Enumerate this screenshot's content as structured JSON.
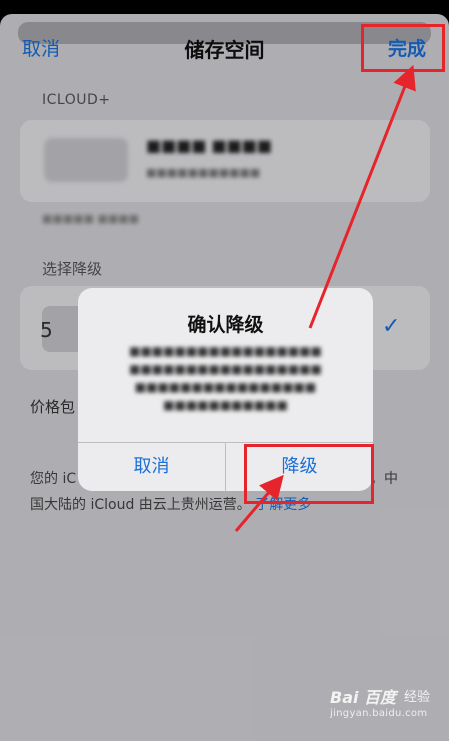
{
  "nav": {
    "cancel_label": "取消",
    "title": "储存空间",
    "done_label": "完成"
  },
  "icloud_section": {
    "header": "ICLOUD+"
  },
  "downgrade_section": {
    "header": "选择降级",
    "option_partial": "5",
    "selected_check": "✓"
  },
  "price_label_partial": "价格包",
  "footer": {
    "line1_left": "您的 iC",
    "line1_right": "销。中",
    "line2_text": "国大陆的 iCloud 由云上贵州运营。",
    "learn_more": "了解更多"
  },
  "alert": {
    "title": "确认降级",
    "cancel_label": "取消",
    "confirm_label": "降级"
  },
  "watermark": {
    "logo": "Bai 百度",
    "text": "经验",
    "url": "jingyan.baidu.com"
  },
  "colors": {
    "accent": "#1a6fd8",
    "highlight": "#e6242b"
  }
}
